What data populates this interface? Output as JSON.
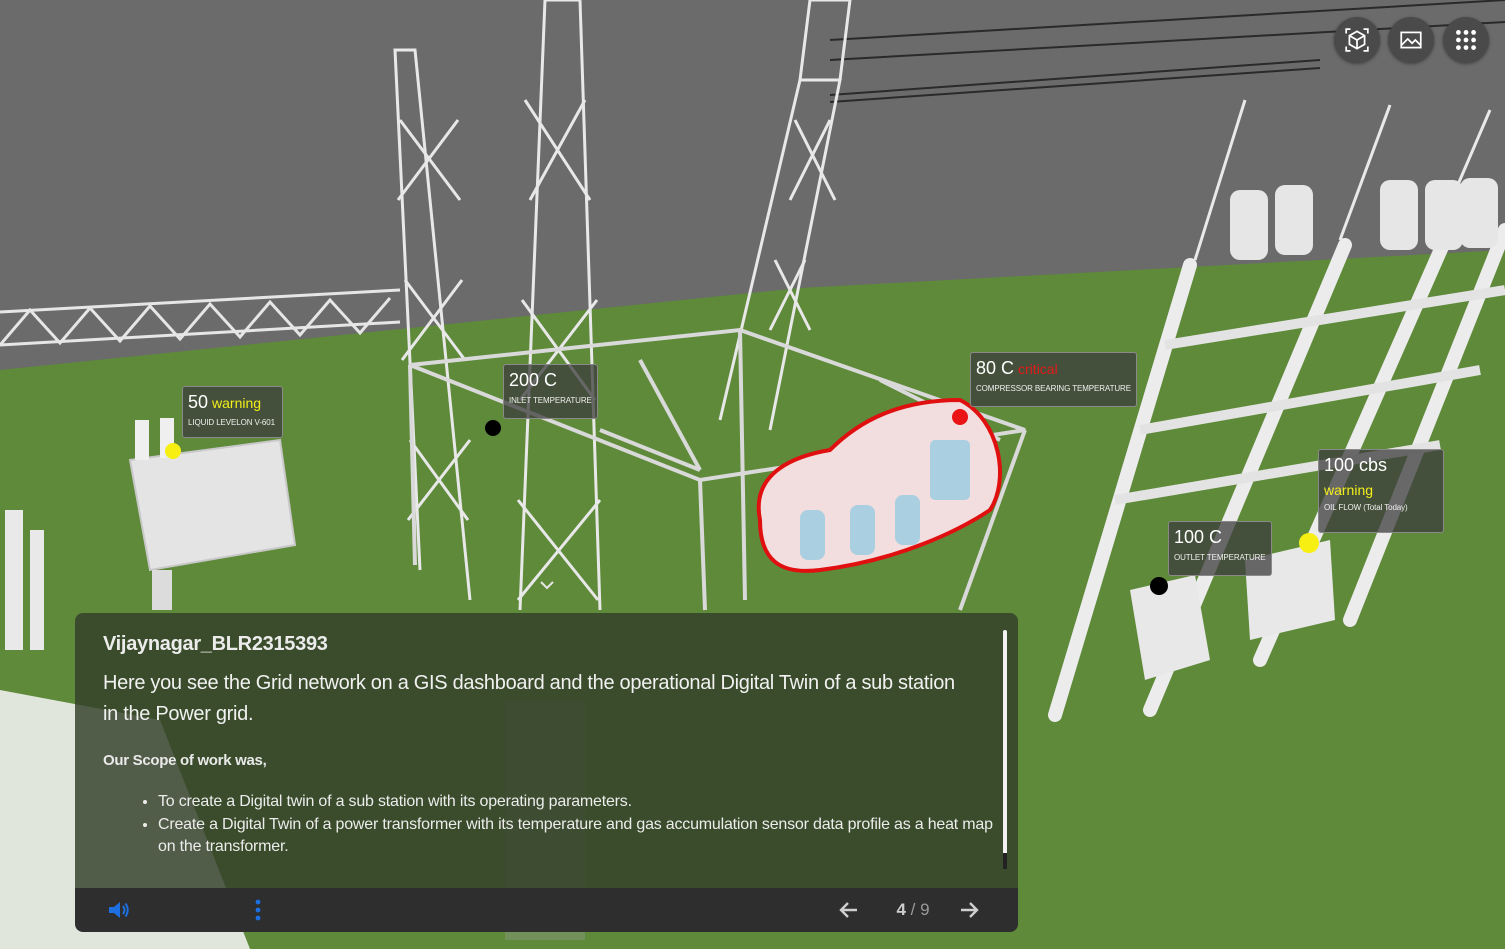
{
  "toolbar": {
    "buttons": [
      {
        "name": "3d-view-icon"
      },
      {
        "name": "image-gallery-icon"
      },
      {
        "name": "apps-grid-icon"
      }
    ]
  },
  "sensors": [
    {
      "value": "50",
      "status": "warning",
      "label": "LIQUID LEVELON V-601",
      "dot": "yellow"
    },
    {
      "value": "200 C",
      "status": "",
      "label": "INLET TEMPERATURE",
      "dot": "black"
    },
    {
      "value": "80 C",
      "status": "critical",
      "label": "COMPRESSOR BEARING TEMPERATURE",
      "dot": "red"
    },
    {
      "value": "100 cbs",
      "status": "warning",
      "label": "OIL FLOW (Total Today)",
      "dot": "yellow"
    },
    {
      "value": "100 C",
      "status": "",
      "label": "OUTLET TEMPERATURE",
      "dot": "black"
    }
  ],
  "panel": {
    "title": "Vijaynagar_BLR2315393",
    "description": "Here you see the Grid network on a GIS dashboard and the operational Digital Twin of a sub station in the Power grid.",
    "scope_heading": "Our Scope of work was,",
    "scope_items": [
      "To create a Digital twin of a sub station with its operating parameters.",
      "Create a Digital Twin of a power transformer with its temperature and gas accumulation sensor data profile as a heat map on the transformer."
    ]
  },
  "pager": {
    "current": "4",
    "total": "/ 9"
  },
  "colors": {
    "ground": "#5e8a3a",
    "sky": "#6b6b6b",
    "warning": "#f3ef1a",
    "critical": "#e21b1b",
    "accent": "#1e6fe0"
  }
}
